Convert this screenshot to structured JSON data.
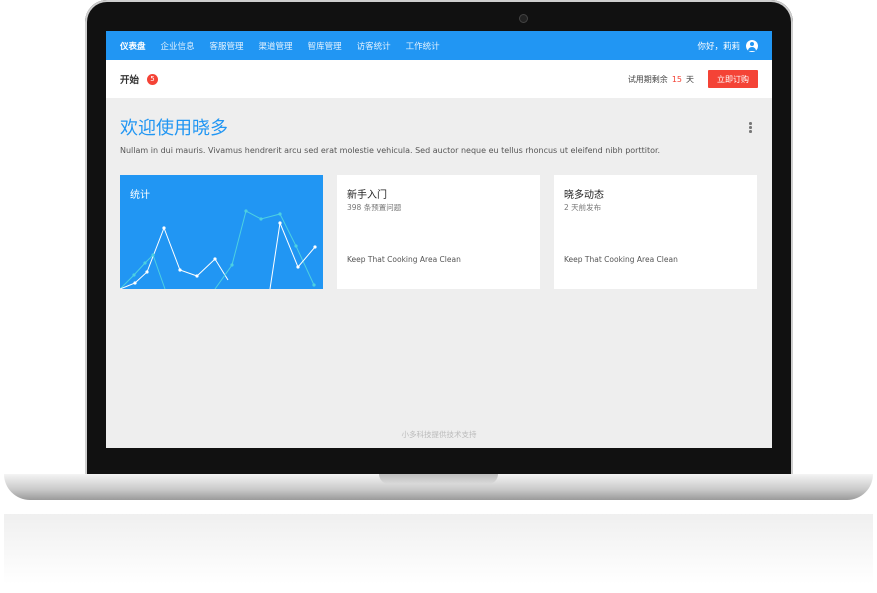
{
  "nav": {
    "items": [
      "仪表盘",
      "企业信息",
      "客服管理",
      "渠道管理",
      "智库管理",
      "访客统计",
      "工作统计"
    ],
    "greeting": "你好，莉莉"
  },
  "subbar": {
    "title": "开始",
    "badge": "5",
    "trial_prefix": "试用期剩余",
    "trial_days": "15",
    "trial_suffix": "天",
    "order_label": "立即订购"
  },
  "welcome": {
    "title": "欢迎使用晓多",
    "description": "Nullam in dui mauris. Vivamus hendrerit arcu sed erat molestie vehicula. Sed auctor neque eu tellus rhoncus ut eleifend nibh porttitor."
  },
  "cards": {
    "stats": {
      "title": "统计"
    },
    "guide": {
      "title": "新手入门",
      "subtitle": "398 条预置问题",
      "footer": "Keep That Cooking Area Clean"
    },
    "news": {
      "title": "晓多动态",
      "subtitle": "2 天前发布",
      "footer": "Keep That Cooking Area Clean"
    }
  },
  "footer": "小多科技提供技术支持",
  "colors": {
    "primary": "#2196f3",
    "danger": "#f44336",
    "background": "#eeeeee"
  },
  "icons": [
    "user-icon",
    "more-vertical-icon",
    "camera-icon"
  ]
}
